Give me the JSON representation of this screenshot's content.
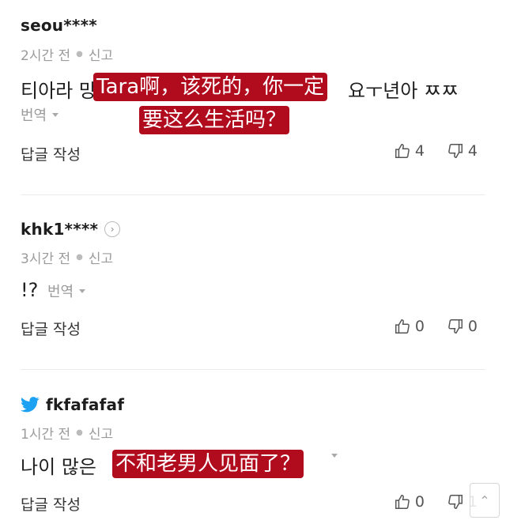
{
  "comments": [
    {
      "username": "seou****",
      "time": "2시간 전",
      "report": "신고",
      "text_left": "티아라 망",
      "text_right": "요ㅜ년아 ㅉㅉ",
      "overlay_line1": "Tara啊，该死的，你一定",
      "overlay_line2": "要这么生活吗？",
      "translate": "번역",
      "reply": "답글 작성",
      "likes": "4",
      "dislikes": "4"
    },
    {
      "username": "khk1****",
      "time": "3시간 전",
      "report": "신고",
      "text": "!?",
      "translate": "번역",
      "reply": "답글 작성",
      "likes": "0",
      "dislikes": "0"
    },
    {
      "username": "fkfafafaf",
      "time": "1시간 전",
      "report": "신고",
      "text": "나이 많은",
      "overlay_line1": "不和老男人见面了？",
      "reply": "답글 작성",
      "likes": "0",
      "dislikes": "1"
    }
  ],
  "icons": {
    "like": "thumbs-up-icon",
    "dislike": "thumbs-down-icon",
    "twitter": "twitter-bird-icon",
    "more": "chevron-right-icon"
  },
  "colors": {
    "overlay": "#b10b1e",
    "twitter": "#1da1f2",
    "meta": "#9b9b9b"
  }
}
